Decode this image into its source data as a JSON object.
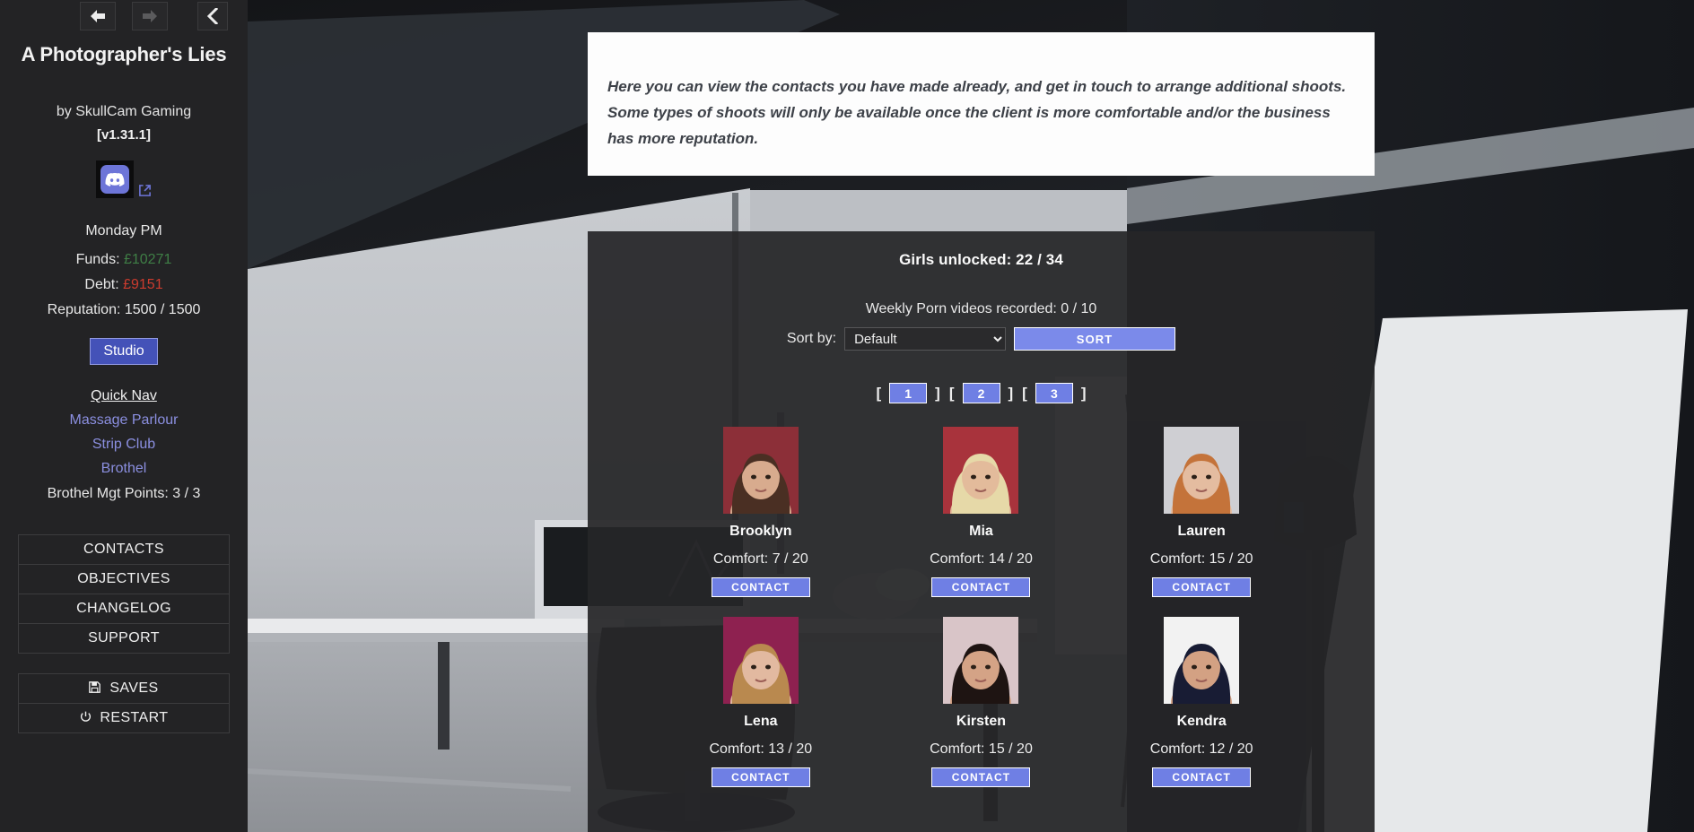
{
  "sidebar": {
    "nav": {
      "back_icon": "arrow-left-icon",
      "forward_icon": "arrow-right-icon",
      "collapse_icon": "chevron-left-icon"
    },
    "game_title": "A Photographer's Lies",
    "author": "by SkullCam Gaming",
    "version": "[v1.31.1]",
    "discord_icon": "discord-icon",
    "external_link_icon": "external-link-icon",
    "daytime": "Monday PM",
    "stats": [
      {
        "label": "Funds:",
        "value": "£10271",
        "value_class": "val-funds"
      },
      {
        "label": "Debt:",
        "value": "£9151",
        "value_class": "val-debt"
      },
      {
        "label": "Reputation:",
        "value": "1500 / 1500",
        "value_class": ""
      }
    ],
    "studio_button": "Studio",
    "quicknav_title": "Quick Nav",
    "quicknav_links": [
      "Massage Parlour",
      "Strip Club",
      "Brothel"
    ],
    "mgt_points": "Brothel Mgt Points: 3 / 3",
    "menu_primary": [
      "CONTACTS",
      "OBJECTIVES",
      "CHANGELOG",
      "SUPPORT"
    ],
    "menu_secondary": [
      {
        "icon": "save-icon",
        "label": "SAVES"
      },
      {
        "icon": "power-icon",
        "label": "RESTART"
      }
    ]
  },
  "info_panel": {
    "text": "Here you can view the contacts you have made already, and get in touch to arrange additional shoots. Some types of shoots will only be available once the client is more comfortable and/or the business has more reputation."
  },
  "content": {
    "girls_unlocked": "Girls unlocked: 22 / 34",
    "videos_recorded": "Weekly Porn videos recorded: 0 / 10",
    "sort_label": "Sort by:",
    "sort_value": "Default",
    "sort_options": [
      "Default"
    ],
    "sort_button": "SORT",
    "pagination": {
      "open_bracket": "[",
      "close_bracket": "]",
      "pages": [
        "1",
        "2",
        "3"
      ]
    },
    "contact_button": "CONTACT",
    "girls": [
      {
        "name": "Brooklyn",
        "comfort": "Comfort: 7 / 20",
        "hair": "#4a2f23",
        "skin": "#d8ab8e",
        "bg": "#8c2f38"
      },
      {
        "name": "Mia",
        "comfort": "Comfort: 14 / 20",
        "hair": "#e6d9a8",
        "skin": "#e3bb9b",
        "bg": "#a8333c"
      },
      {
        "name": "Lauren",
        "comfort": "Comfort: 15 / 20",
        "hair": "#c4733a",
        "skin": "#e4bca0",
        "bg": "#cfcfd3"
      },
      {
        "name": "Lena",
        "comfort": "Comfort: 13 / 20",
        "hair": "#b9894f",
        "skin": "#e2b9a0",
        "bg": "#8e2150"
      },
      {
        "name": "Kirsten",
        "comfort": "Comfort: 15 / 20",
        "hair": "#1e1412",
        "skin": "#d4a386",
        "bg": "#d9c5c8"
      },
      {
        "name": "Kendra",
        "comfort": "Comfort: 12 / 20",
        "hair": "#181c34",
        "skin": "#d3a183",
        "bg": "#f2f2f2"
      }
    ]
  },
  "colors": {
    "accent_blue": "#6f7fe4",
    "sort_blue": "#7b8aea",
    "studio_blue": "#4452b8",
    "link_purple": "#8b8fe0",
    "funds_green": "#3f7f46",
    "debt_red": "#cc3b2e",
    "sidebar_bg": "#232325",
    "panel_bg": "#262628"
  }
}
